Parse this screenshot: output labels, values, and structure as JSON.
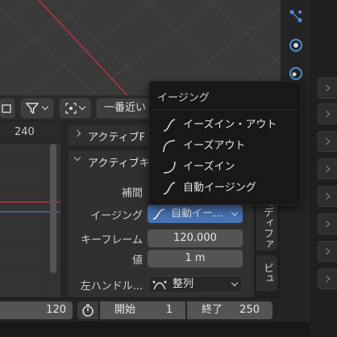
{
  "graph": {
    "ruler_number": "240"
  },
  "header": {
    "snap_label": "一番近い"
  },
  "sidebar": {
    "panel1_title": "アクティブF",
    "panel2_title": "アクティブキ",
    "props": {
      "interpolation_label": "補間",
      "easing_label": "イージング",
      "easing_value": "自動イー...",
      "keyframe_label": "キーフレーム",
      "keyframe_value": "120.000",
      "value_label": "値",
      "value_value": "1 m",
      "left_handle_label": "左ハンドル...",
      "left_handle_value": "整列"
    }
  },
  "vtabs": {
    "tab1": "モディファ",
    "tab2": "ビュ"
  },
  "popup": {
    "title": "イージング",
    "items": [
      "イーズイン・アウト",
      "イーズアウト",
      "イーズイン",
      "自動イージング"
    ]
  },
  "timeline": {
    "current_frame": "120",
    "start_label": "開始",
    "start_value": "1",
    "end_label": "終了",
    "end_value": "250"
  },
  "colors": {
    "accent_blue": "#4772b3",
    "axis_red": "#b8343c",
    "axis_blue": "#3f6bb5"
  }
}
